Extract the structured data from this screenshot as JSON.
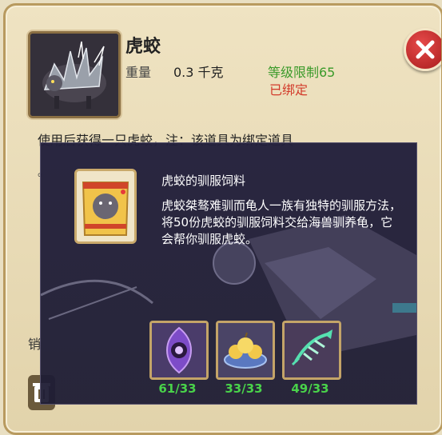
{
  "item": {
    "name": "虎蛟",
    "weight_label": "重量",
    "weight_value": "0.3 千克",
    "level_limit": "等级限制65",
    "bound_status": "已绑定",
    "description": "使用后获得一只虎蛟，注：该道具为绑定道具",
    "bullet": "。",
    "side_label": "销"
  },
  "popup": {
    "title": "虎蛟的驯服饲料",
    "description": "虎蛟桀骜难驯而龟人一族有独特的驯服方法，将50份虎蛟的驯服饲料交给海兽驯养龟，它会帮你驯服虎蛟。",
    "ingredients": [
      {
        "icon": "purple-eye-gem-icon",
        "count": "61/33"
      },
      {
        "icon": "golden-fruit-plate-icon",
        "count": "33/33"
      },
      {
        "icon": "green-fish-skeleton-icon",
        "count": "49/33"
      }
    ]
  },
  "colors": {
    "panel_bg": "#e9dfc2",
    "green": "#3a9a2a",
    "red": "#d23a2a",
    "count_green": "#49d24a"
  }
}
